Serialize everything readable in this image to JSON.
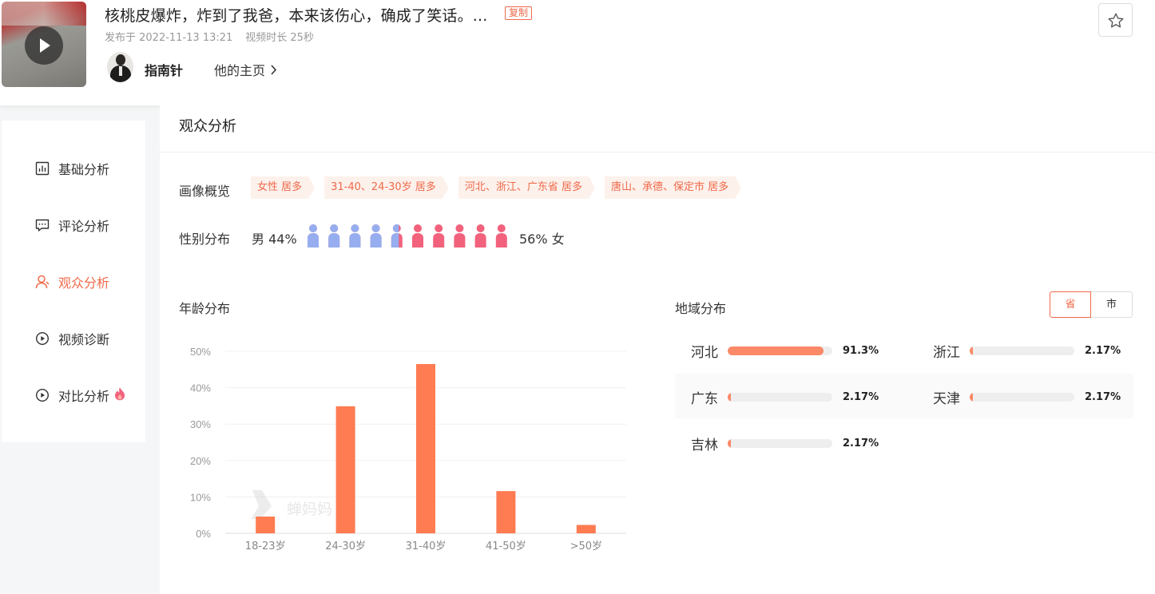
{
  "video": {
    "title": "核桃皮爆炸，炸到了我爸，本来该伤心，确成了笑话。...",
    "copy_label": "复制",
    "published": "发布于 2022-11-13 13:21",
    "duration": "视频时长 25秒"
  },
  "author": {
    "name": "指南针",
    "home_link": "他的主页"
  },
  "sidebar": {
    "items": [
      {
        "label": "基础分析",
        "icon": "bar-chart-icon"
      },
      {
        "label": "评论分析",
        "icon": "comment-icon"
      },
      {
        "label": "观众分析",
        "icon": "user-icon",
        "active": true
      },
      {
        "label": "视频诊断",
        "icon": "play-circle-icon"
      },
      {
        "label": "对比分析",
        "icon": "play-circle-icon",
        "badge": "flame-icon"
      }
    ]
  },
  "audience": {
    "section_title": "观众分析",
    "profile_label": "画像概览",
    "profile_tags": [
      "女性 居多",
      "31-40、24-30岁 居多",
      "河北、浙江、广东省 居多",
      "唐山、承德、保定市 居多"
    ],
    "gender_label": "性别分布",
    "male_text": "男 44%",
    "female_text": "56% 女",
    "male_fraction": 0.44,
    "colors": {
      "male": "#96aef0",
      "female": "#f2627c",
      "accent": "#f06a4a",
      "bar": "#ff7b52"
    }
  },
  "age": {
    "title": "年龄分布",
    "watermark": "蝉妈妈"
  },
  "chart_data": {
    "type": "bar",
    "categories": [
      "18-23岁",
      "24-30岁",
      "31-40岁",
      "41-50岁",
      ">50岁"
    ],
    "values": [
      4.6,
      34.9,
      46.5,
      11.6,
      2.3
    ],
    "ylim": [
      0,
      50
    ],
    "yticks": [
      "0%",
      "10%",
      "20%",
      "30%",
      "40%",
      "50%"
    ],
    "grid": true
  },
  "region": {
    "title": "地域分布",
    "toggle": [
      "省",
      "市"
    ],
    "active_toggle": "省",
    "items": [
      {
        "name": "河北",
        "pct": "91.3%",
        "value": 91.3
      },
      {
        "name": "浙江",
        "pct": "2.17%",
        "value": 2.17
      },
      {
        "name": "广东",
        "pct": "2.17%",
        "value": 2.17
      },
      {
        "name": "天津",
        "pct": "2.17%",
        "value": 2.17
      },
      {
        "name": "吉林",
        "pct": "2.17%",
        "value": 2.17
      }
    ]
  }
}
